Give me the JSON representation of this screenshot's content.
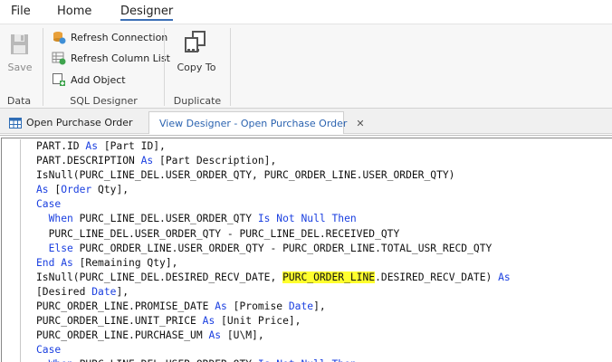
{
  "menu": {
    "items": [
      "File",
      "Home",
      "Designer"
    ],
    "active": "Designer"
  },
  "ribbon": {
    "data_group": {
      "label": "Data",
      "save_label": "Save"
    },
    "sql_group": {
      "label": "SQL Designer",
      "refresh_connection": "Refresh Connection",
      "refresh_column_list": "Refresh Column List",
      "add_object": "Add Object"
    },
    "duplicate_group": {
      "label": "Duplicate",
      "copy_to": "Copy To"
    }
  },
  "tabs": [
    {
      "label": "Open Purchase Order",
      "active": false
    },
    {
      "label": "View Designer - Open Purchase Order",
      "active": true,
      "close": "✕"
    }
  ],
  "colors": {
    "keyword": "#1a3fe0",
    "highlight": "#ffff2e",
    "active_tab": "#2b63b0",
    "accent": "#3b6fb6"
  },
  "code_lines": [
    {
      "indent": 0,
      "tokens": [
        {
          "t": "PART.ID "
        },
        {
          "t": "As",
          "k": 1
        },
        {
          "t": " [Part ID],"
        }
      ]
    },
    {
      "indent": 0,
      "tokens": [
        {
          "t": "PART.DESCRIPTION "
        },
        {
          "t": "As",
          "k": 1
        },
        {
          "t": " [Part Description],"
        }
      ]
    },
    {
      "indent": 0,
      "tokens": [
        {
          "t": "IsNull(PURC_LINE_DEL.USER_ORDER_QTY, PURC_ORDER_LINE.USER_ORDER_QTY)"
        }
      ]
    },
    {
      "indent": 0,
      "tokens": [
        {
          "t": "As",
          "k": 1
        },
        {
          "t": " ["
        },
        {
          "t": "Order",
          "k": 1
        },
        {
          "t": " Qty],"
        }
      ]
    },
    {
      "indent": 0,
      "tokens": [
        {
          "t": "Case",
          "k": 1
        }
      ]
    },
    {
      "indent": 2,
      "tokens": [
        {
          "t": "When",
          "k": 1
        },
        {
          "t": " PURC_LINE_DEL.USER_ORDER_QTY "
        },
        {
          "t": "Is Not Null Then",
          "k": 1
        }
      ]
    },
    {
      "indent": 2,
      "tokens": [
        {
          "t": "PURC_LINE_DEL.USER_ORDER_QTY - PURC_LINE_DEL.RECEIVED_QTY"
        }
      ]
    },
    {
      "indent": 2,
      "tokens": [
        {
          "t": "Else",
          "k": 1
        },
        {
          "t": " PURC_ORDER_LINE.USER_ORDER_QTY - PURC_ORDER_LINE.TOTAL_USR_RECD_QTY"
        }
      ]
    },
    {
      "indent": 0,
      "tokens": [
        {
          "t": "End As",
          "k": 1
        },
        {
          "t": " [Remaining Qty],"
        }
      ]
    },
    {
      "indent": 0,
      "tokens": [
        {
          "t": "IsNull(PURC_LINE_DEL.DESIRED_RECV_DATE, "
        },
        {
          "t": "PURC_ORDER_LINE",
          "h": 1
        },
        {
          "t": ".DESIRED_RECV_DATE) "
        },
        {
          "t": "As",
          "k": 1
        }
      ]
    },
    {
      "indent": 0,
      "tokens": [
        {
          "t": "[Desired "
        },
        {
          "t": "Date",
          "k": 1
        },
        {
          "t": "],"
        }
      ]
    },
    {
      "indent": 0,
      "tokens": [
        {
          "t": "PURC_ORDER_LINE.PROMISE_DATE "
        },
        {
          "t": "As",
          "k": 1
        },
        {
          "t": " [Promise "
        },
        {
          "t": "Date",
          "k": 1
        },
        {
          "t": "],"
        }
      ]
    },
    {
      "indent": 0,
      "tokens": [
        {
          "t": "PURC_ORDER_LINE.UNIT_PRICE "
        },
        {
          "t": "As",
          "k": 1
        },
        {
          "t": " [Unit Price],"
        }
      ]
    },
    {
      "indent": 0,
      "tokens": [
        {
          "t": "PURC_ORDER_LINE.PURCHASE_UM "
        },
        {
          "t": "As",
          "k": 1
        },
        {
          "t": " [U\\M],"
        }
      ]
    },
    {
      "indent": 0,
      "tokens": [
        {
          "t": "Case",
          "k": 1
        }
      ]
    },
    {
      "indent": 2,
      "tokens": [
        {
          "t": "When",
          "k": 1
        },
        {
          "t": " PURC_LINE_DEL.USER_ORDER_QTY "
        },
        {
          "t": "Is Not Null Then",
          "k": 1
        }
      ]
    }
  ]
}
